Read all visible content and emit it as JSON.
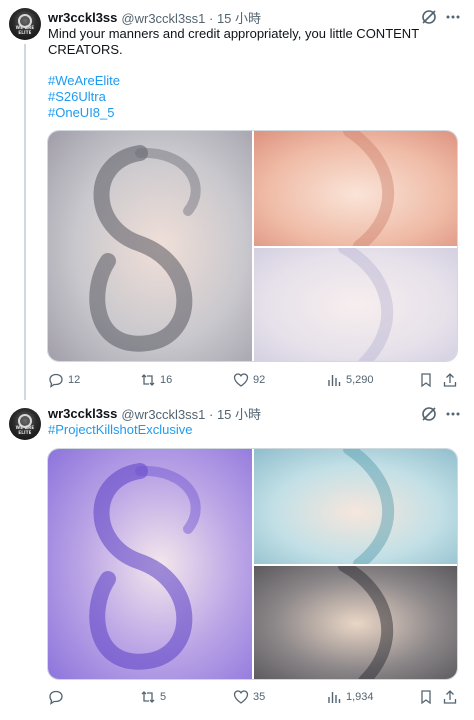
{
  "tweets": [
    {
      "display_name": "wr3cckl3ss",
      "handle_time": "@wr3cckl3ss1 · 15 小時",
      "avatar_text": "WE ARE ELITE",
      "text_line1": "Mind your manners and credit appropriately, you little CONTENT",
      "text_line2": "CREATORS.",
      "hashtags": [
        "#WeAreElite",
        "#S26Ultra",
        "#OneUI8_5"
      ],
      "replies": "12",
      "reposts": "16",
      "likes": "92",
      "views": "5,290",
      "media_colors": {
        "large": [
          "#eae6ea",
          "#c7c6cb",
          "#8e8c96"
        ],
        "top_right": [
          "#f7dccd",
          "#eeb8a2",
          "#dc8f7c"
        ],
        "bottom_right": [
          "#f5eeef",
          "#e5e0ea",
          "#cfcbe0"
        ]
      }
    },
    {
      "display_name": "wr3cckl3ss",
      "handle_time": "@wr3cckl3ss1 · 15 小時",
      "avatar_text": "WE ARE ELITE",
      "hashtags": [
        "#ProjectKillshotExclusive"
      ],
      "replies": "",
      "reposts": "5",
      "likes": "35",
      "views": "1,934",
      "media_colors": {
        "large": [
          "#f2e4ec",
          "#b7a2e4",
          "#7d64d6"
        ],
        "top_right": [
          "#f4e6dc",
          "#bfdde4",
          "#7cb3c4"
        ],
        "bottom_right": [
          "#e8d4c4",
          "#8a8688",
          "#4a4a4e"
        ]
      }
    }
  ],
  "icons": {
    "grok": "grok-icon",
    "more": "more-icon",
    "reply": "reply-icon",
    "repost": "repost-icon",
    "like": "like-icon",
    "views": "views-icon",
    "bookmark": "bookmark-icon",
    "share": "share-icon"
  }
}
